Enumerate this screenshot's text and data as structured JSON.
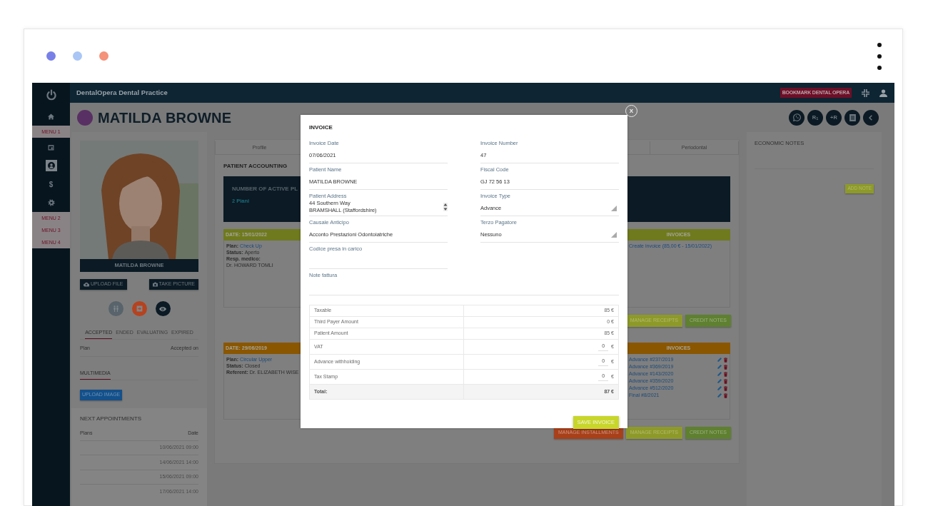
{
  "frame": {
    "dots": [
      {
        "color": "#7880e8"
      },
      {
        "color": "#a9c6f5"
      },
      {
        "color": "#f4927a"
      }
    ]
  },
  "navbar": {
    "brand": "DentalOpera Dental Practice",
    "bookmark": "BOOKMARK DENTAL OPERA"
  },
  "sidebar": {
    "items": [
      {
        "kind": "icon",
        "selected": false
      },
      {
        "kind": "menu",
        "label": "MENU 1"
      },
      {
        "kind": "icon",
        "selected": false
      },
      {
        "kind": "icon",
        "selected": true
      },
      {
        "kind": "glyph",
        "label": "$",
        "selected": false
      },
      {
        "kind": "icon",
        "selected": false
      },
      {
        "kind": "menu",
        "label": "MENU 2"
      },
      {
        "kind": "menu",
        "label": "MENU 3"
      },
      {
        "kind": "menu",
        "label": "MENU 4"
      }
    ]
  },
  "patient": {
    "name": "MATILDA BROWNE",
    "caption": "MATILDA BROWNE"
  },
  "header_actions": [
    {
      "kind": "icon"
    },
    {
      "kind": "text",
      "label": "R$_{1}$"
    },
    {
      "kind": "text",
      "label": "+R"
    },
    {
      "kind": "icon"
    },
    {
      "kind": "icon"
    }
  ],
  "photo_buttons": [
    "UPLOAD FILE",
    "TAKE PICTURE"
  ],
  "quick_actions": [
    {
      "color": "#58636b"
    },
    {
      "color": "#b5431f"
    },
    {
      "color": "#0b1a24"
    }
  ],
  "plan_tabs": [
    {
      "label": "ACCEPTED",
      "selected": true
    },
    {
      "label": "ENDED",
      "selected": false
    },
    {
      "label": "EVALUATING",
      "selected": false
    },
    {
      "label": "EXPIRED",
      "selected": false
    }
  ],
  "plan_table": {
    "columns": [
      "Plan",
      "Accepted on"
    ]
  },
  "multimedia": {
    "tab": "MULTIMEDIA",
    "button": "UPLOAD IMAGE"
  },
  "appointments": {
    "title": "NEXT APPOINTMENTS",
    "columns": [
      "Plans",
      "Date"
    ],
    "rows": [
      {
        "date": "10/06/2021 09:00"
      },
      {
        "date": "14/06/2021 14:00"
      },
      {
        "date": "15/06/2021 09:00"
      },
      {
        "date": "17/06/2021 14:00"
      }
    ]
  },
  "accounting": {
    "tabs": [
      {
        "label": "Profile",
        "selected": false
      },
      {
        "label": "Periodontal",
        "selected": false
      }
    ],
    "title": "PATIENT ACCOUNTING",
    "summary": {
      "title": "NUMBER OF ACTIVE PL",
      "value": "2 Piani"
    },
    "plans": [
      {
        "date": "DATE: 15/01/2022",
        "color": "#6f7a1e",
        "fields": [
          {
            "label": "Plan:",
            "value": "Check Up",
            "link": true
          },
          {
            "label": "Status:",
            "value": "Aperto",
            "link": false
          },
          {
            "label": "Resp. medico:",
            "value": "Dr. HOWARD TOMLI",
            "link": false
          }
        ],
        "invoices_title": "INVOICES",
        "invoices": [
          {
            "text": "Create invoice (85,00 € - 15/01/2022)",
            "kind": "create"
          }
        ],
        "buttons": [
          {
            "label": "MANAGE RECEIPTS",
            "kind": "receipts"
          },
          {
            "label": "CREDIT NOTES",
            "kind": "credit"
          }
        ]
      },
      {
        "date": "DATE: 29/06/2019",
        "color": "#8a5600",
        "fields": [
          {
            "label": "Plan:",
            "value": "Circular Upper",
            "link": true
          },
          {
            "label": "Status:",
            "value": "Closed",
            "link": false
          },
          {
            "label": "Referent:",
            "value": "Dr. ELIZABETH WISE",
            "link": false
          }
        ],
        "invoices_title": "INVOICES",
        "invoices": [
          {
            "text": "Advance #237/2019",
            "kind": "document"
          },
          {
            "text": "Advance #369/2019",
            "kind": "document"
          },
          {
            "text": "Advance #143/2020",
            "kind": "document"
          },
          {
            "text": "Advance #359/2020",
            "kind": "document"
          },
          {
            "text": "Advance #512/2020",
            "kind": "document"
          },
          {
            "text": "Final #8/2021",
            "kind": "document"
          }
        ],
        "buttons": [
          {
            "label": "MANAGE INSTALLMENTS",
            "kind": "installments"
          },
          {
            "label": "MANAGE RECEIPTS",
            "kind": "receipts"
          },
          {
            "label": "CREDIT NOTES",
            "kind": "credit"
          }
        ]
      }
    ]
  },
  "economic_notes": {
    "title": "ECONOMIC NOTES",
    "button": "ADD NOTE"
  },
  "modal": {
    "close": "X",
    "title": "INVOICE",
    "fields": [
      {
        "label": "Invoice Date",
        "value": "07/06/2021",
        "kind": "text"
      },
      {
        "label": "Invoice Number",
        "value": "47",
        "kind": "text"
      },
      {
        "label": "Patient Name",
        "value": "MATILDA BROWNE",
        "kind": "text"
      },
      {
        "label": "Fiscal Code",
        "value": "GJ 72 56 13",
        "kind": "text"
      },
      {
        "label": "Patient Address",
        "value": "44 Southern Way\nBRAMSHALL (Staffordshire)",
        "kind": "textarea"
      },
      {
        "label": "Invoice Type",
        "value": "Advance",
        "kind": "select"
      },
      {
        "label": "Causale Anticipo",
        "value": "Acconto Prestazioni Odontoiatriche",
        "kind": "text"
      },
      {
        "label": "Terzo Pagatore",
        "value": "Nessuno",
        "kind": "select"
      },
      {
        "label": "Codice presa in carico",
        "kind": "text"
      },
      {
        "label": "Note fattura",
        "kind": "note"
      }
    ],
    "totals": [
      {
        "label": "Taxable",
        "value": "85 €",
        "kind": "static"
      },
      {
        "label": "Third Payer Amount",
        "value": "0 €",
        "kind": "static"
      },
      {
        "label": "Patient Amount",
        "value": "85 €",
        "kind": "static"
      },
      {
        "label": "VAT",
        "value": "0",
        "unit": "€",
        "kind": "input"
      },
      {
        "label": "Advance withholding",
        "value": "0",
        "unit": "€",
        "kind": "input"
      },
      {
        "label": "Tax Stamp",
        "value": "0",
        "unit": "€",
        "kind": "input"
      },
      {
        "label": "Total:",
        "value": "87 €",
        "kind": "total"
      }
    ],
    "save": "SAVE INVOICE"
  }
}
